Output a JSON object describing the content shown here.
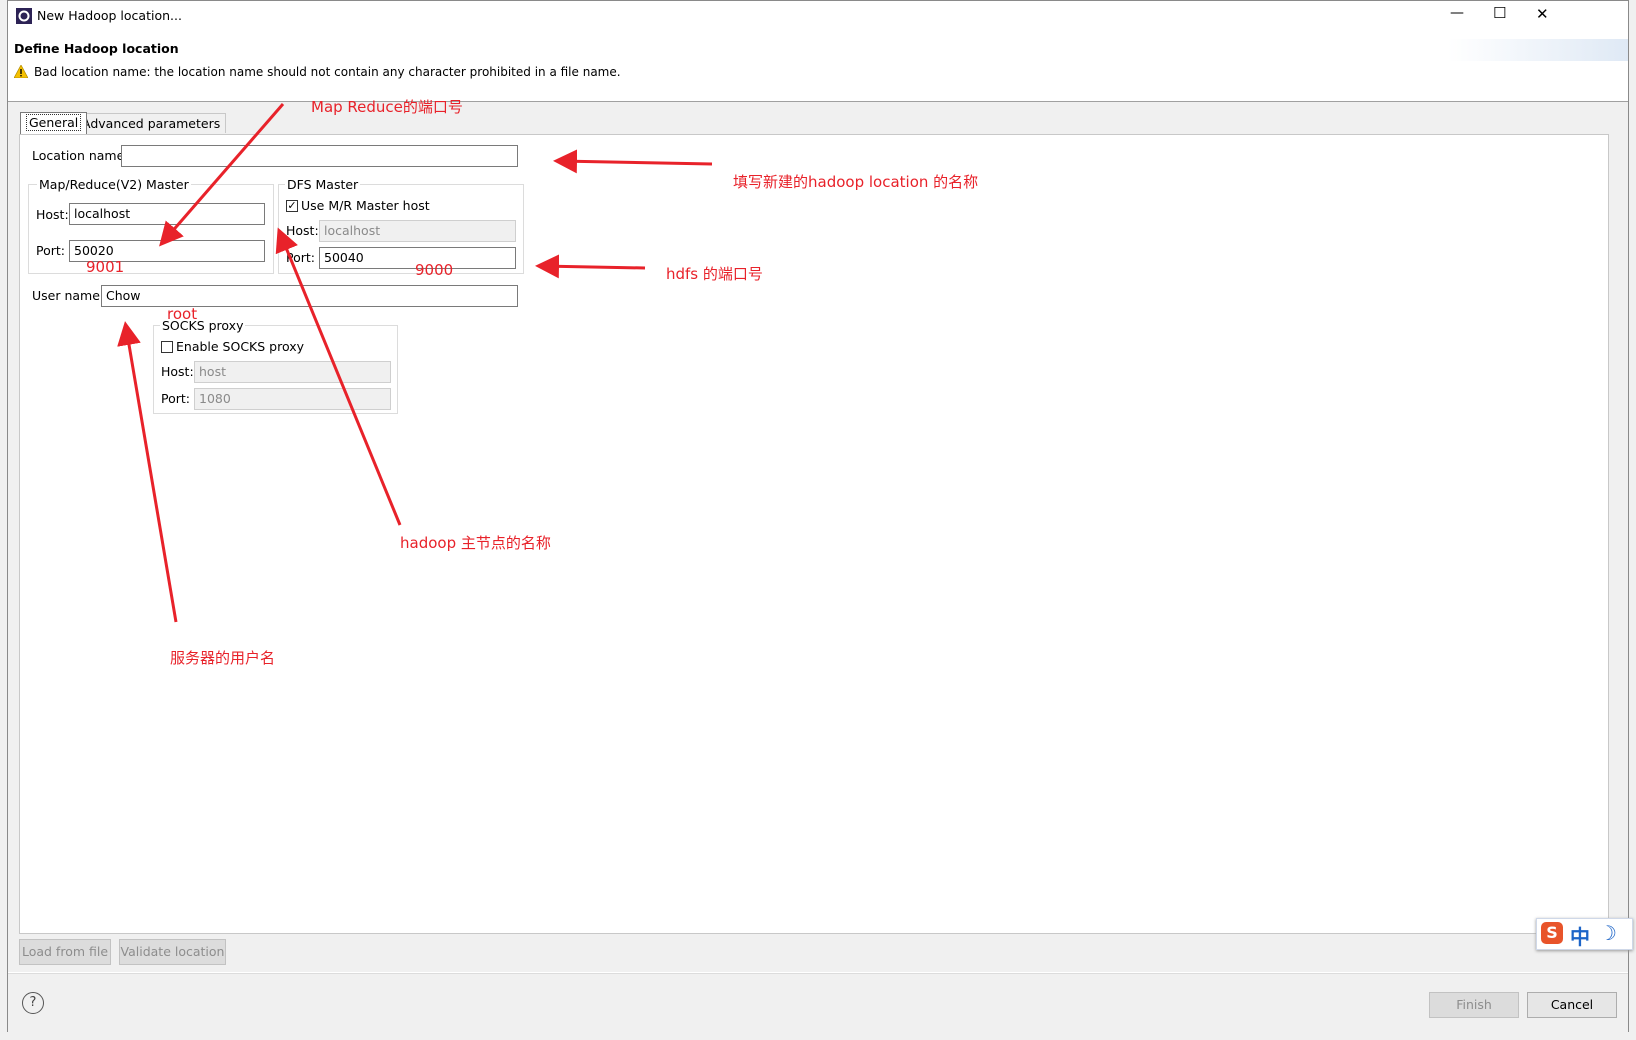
{
  "window": {
    "title": "New Hadoop location...",
    "controls": {
      "minimize": "—",
      "maximize": "☐",
      "close": "✕"
    }
  },
  "header": {
    "title": "Define Hadoop location",
    "message": "Bad location name: the location name should not contain any character prohibited in a file name."
  },
  "tabs": [
    {
      "label": "General",
      "active": true
    },
    {
      "label": "Advanced parameters",
      "active": false
    }
  ],
  "form": {
    "location_name": {
      "label": "Location name:",
      "value": ""
    },
    "mr_master": {
      "title": "Map/Reduce(V2) Master",
      "host_label": "Host:",
      "host_value": "localhost",
      "port_label": "Port:",
      "port_value": "50020"
    },
    "dfs_master": {
      "title": "DFS Master",
      "use_mr_host_label": "Use M/R Master host",
      "use_mr_host_checked": true,
      "host_label": "Host:",
      "host_value": "localhost",
      "port_label": "Port:",
      "port_value": "50040"
    },
    "user_name": {
      "label": "User name:",
      "value": "Chow"
    },
    "socks": {
      "title": "SOCKS proxy",
      "enable_label": "Enable SOCKS proxy",
      "enabled": false,
      "host_label": "Host:",
      "host_value": "host",
      "port_label": "Port:",
      "port_value": "1080"
    }
  },
  "buttons": {
    "load_from_file": "Load from file",
    "validate_location": "Validate location",
    "finish": "Finish",
    "cancel": "Cancel",
    "help": "?"
  },
  "ime": {
    "logo": "S",
    "mode": "中",
    "moon": "☽"
  },
  "annotations": {
    "mr_port_title": "Map Reduce的端口号",
    "location_name_hint": "填写新建的hadoop location 的名称",
    "hdfs_port_hint": "hdfs 的端口号",
    "mr_port_value": "9001",
    "dfs_port_value": "9000",
    "user_value": "root",
    "master_name_hint": "hadoop 主节点的名称",
    "user_hint": "服务器的用户名"
  },
  "colors": {
    "annotation": "#e8222a",
    "warning": "#f5c000"
  }
}
